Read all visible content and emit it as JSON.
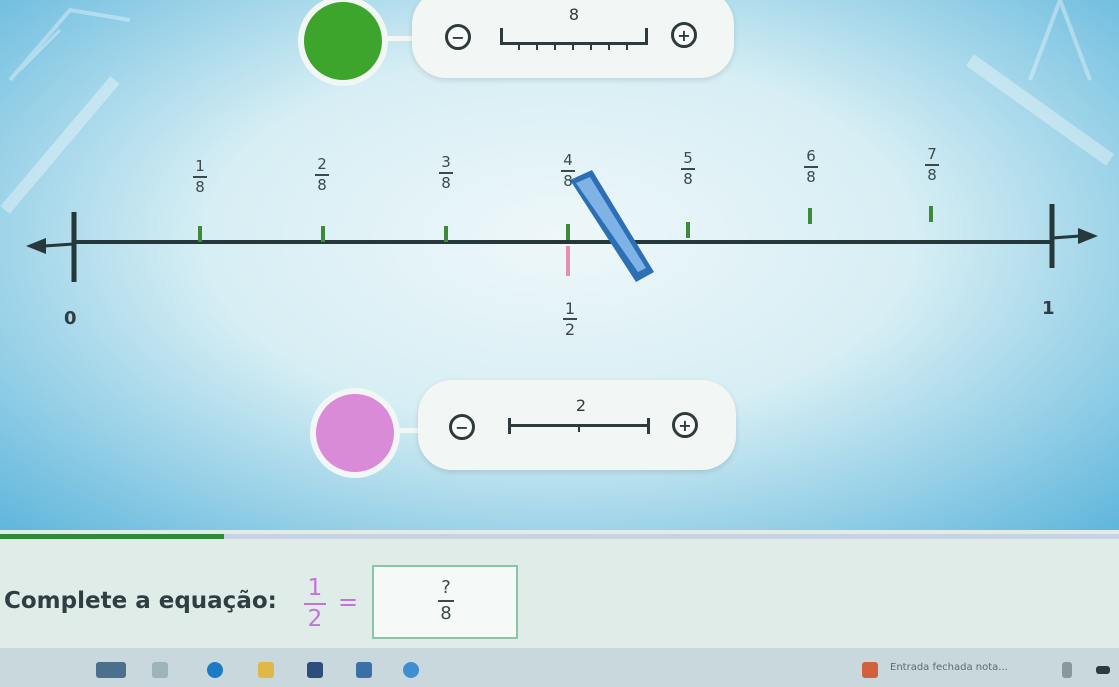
{
  "top_control": {
    "color": "#3ea52c",
    "minus_label": "−",
    "plus_label": "+",
    "value": "8"
  },
  "number_line": {
    "start_label": "0",
    "end_label": "1",
    "top_fractions": [
      {
        "num": "1",
        "den": "8"
      },
      {
        "num": "2",
        "den": "8"
      },
      {
        "num": "3",
        "den": "8"
      },
      {
        "num": "4",
        "den": "8"
      },
      {
        "num": "5",
        "den": "8"
      },
      {
        "num": "6",
        "den": "8"
      },
      {
        "num": "7",
        "den": "8"
      }
    ],
    "bottom_fraction": {
      "num": "1",
      "den": "2"
    },
    "tick_color_top": "#3f8a3a",
    "tick_color_bottom": "#e58fb5"
  },
  "bottom_control": {
    "color": "#d98bd8",
    "minus_label": "−",
    "plus_label": "+",
    "value": "2"
  },
  "question": {
    "prompt": "Complete a equação:",
    "left_num": "1",
    "left_den": "2",
    "equals": "=",
    "answer_num": "?",
    "answer_den": "8"
  },
  "progress": {
    "fraction": 0.2
  },
  "taskbar": {
    "status_text": "Entrada fechada nota..."
  }
}
